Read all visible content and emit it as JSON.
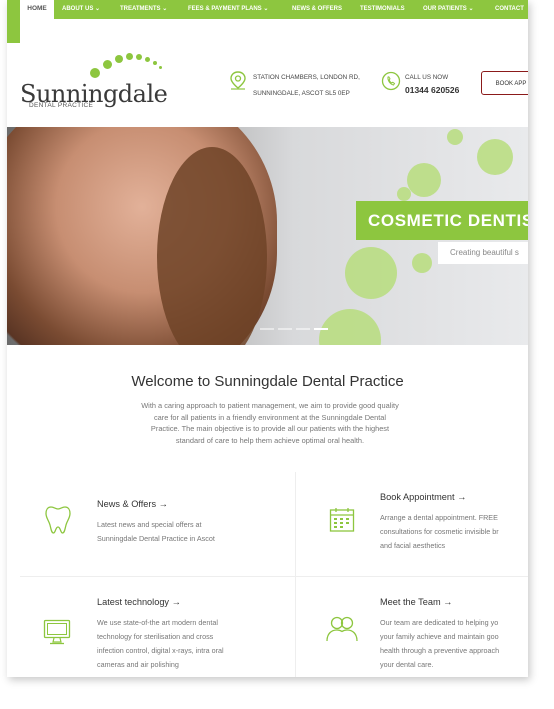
{
  "nav": {
    "items": [
      {
        "label": "HOME"
      },
      {
        "label": "ABOUT US ⌄"
      },
      {
        "label": "TREATMENTS ⌄"
      },
      {
        "label": "FEES & PAYMENT PLANS ⌄"
      },
      {
        "label": "NEWS & OFFERS"
      },
      {
        "label": "TESTIMONIALS"
      },
      {
        "label": "OUR PATIENTS ⌄"
      },
      {
        "label": "CONTACT"
      }
    ],
    "active_color": "#8dc63f"
  },
  "logo": {
    "name": "Sunningdale",
    "sub": "DENTAL PRACTICE"
  },
  "address": {
    "line1": "STATION CHAMBERS, LONDON RD,",
    "line2": "SUNNINGDALE, ASCOT SL5 0EP"
  },
  "phone": {
    "label": "CALL US NOW",
    "number": "01344 620526"
  },
  "book_button": "BOOK APP",
  "hero": {
    "banner_title": "COSMETIC DENTIS",
    "banner_sub": "Creating beautiful s"
  },
  "welcome": {
    "title": "Welcome to Sunningdale Dental Practice",
    "text": "With a caring approach to patient management, we aim to provide good quality care for all patients in a friendly environment at the Sunningdale Dental Practice. The main objective is to provide all our patients with the highest standard of care to help them achieve optimal oral health."
  },
  "features": {
    "news": {
      "title": "News & Offers →",
      "desc_lines": [
        "Latest news and special offers at",
        "Sunningdale Dental Practice in Ascot"
      ],
      "icon": "tooth-icon"
    },
    "book": {
      "title": "Book Appointment →",
      "desc_lines": [
        "Arrange a dental appointment. FREE",
        "consultations for cosmetic invisible br",
        "and facial aesthetics"
      ],
      "icon": "calendar-icon"
    },
    "tech": {
      "title": "Latest technology →",
      "desc_lines": [
        "We use state-of-the art modern dental",
        "technology for sterilisation and cross",
        "infection control, digital x-rays, intra oral",
        "cameras and air polishing"
      ],
      "icon": "monitor-icon"
    },
    "team": {
      "title": "Meet the Team →",
      "desc_lines": [
        "Our team are dedicated to helping yo",
        "your family achieve and maintain goo",
        "health through a preventive approach",
        "your dental care."
      ],
      "icon": "team-icon"
    }
  },
  "colors": {
    "brand_green": "#8dc63f",
    "light_green": "#b7dd7d",
    "text_dark": "#333333",
    "text_muted": "#777777"
  }
}
